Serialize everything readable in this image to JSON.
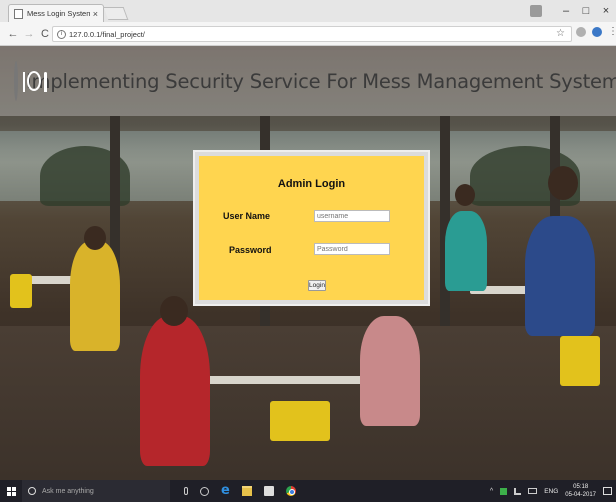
{
  "browser": {
    "tab_title": "Mess Login System",
    "tab_close": "×",
    "url": "127.0.0.1/final_project/",
    "info_icon": "i",
    "star_icon": "☆",
    "window_controls": {
      "minimize": "–",
      "maximize": "□",
      "close": "×"
    },
    "nav": {
      "back": "←",
      "forward": "→",
      "reload": "C"
    },
    "menu_icon": "⋮"
  },
  "banner": {
    "title": "Implementing Security Service For Mess Management System Using PHP."
  },
  "login": {
    "title": "Admin Login",
    "username_label": "User Name",
    "username_placeholder": "username",
    "password_label": "Password",
    "password_placeholder": "Password",
    "submit_label": "Login"
  },
  "taskbar": {
    "search_placeholder": "Ask me anything",
    "edge_glyph": "e",
    "tray_up": "^",
    "language": "ENG",
    "time": "05:18",
    "date": "05-04-2017"
  },
  "colors": {
    "login_card": "#ffd54f",
    "taskbar": "#1f1f27"
  }
}
